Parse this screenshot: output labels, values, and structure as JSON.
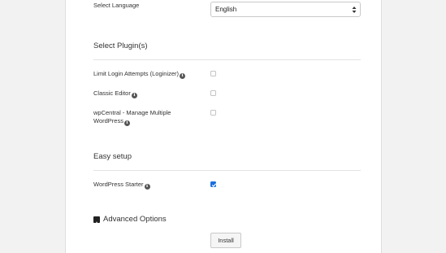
{
  "language": {
    "label": "Select Language",
    "selected": "English"
  },
  "plugins": {
    "title": "Select Plugin(s)",
    "items": [
      {
        "line1": "Limit Login Attempts (Loginizer)",
        "line2": "",
        "checked": false
      },
      {
        "line1": "Classic Editor",
        "line2": "",
        "checked": false
      },
      {
        "line1": "wpCentral - Manage Multiple",
        "line2": "WordPress",
        "checked": false
      }
    ]
  },
  "easy_setup": {
    "title": "Easy setup",
    "items": [
      {
        "line1": "WordPress Starter",
        "checked": true
      }
    ]
  },
  "advanced": {
    "label": "Advanced Options",
    "icon": "plus-square-icon"
  },
  "actions": {
    "install_label": "Install"
  },
  "colors": {
    "checkbox_checked": "#1e6fdc",
    "panel_bg": "#ffffff",
    "page_bg": "#f2f2f2"
  }
}
